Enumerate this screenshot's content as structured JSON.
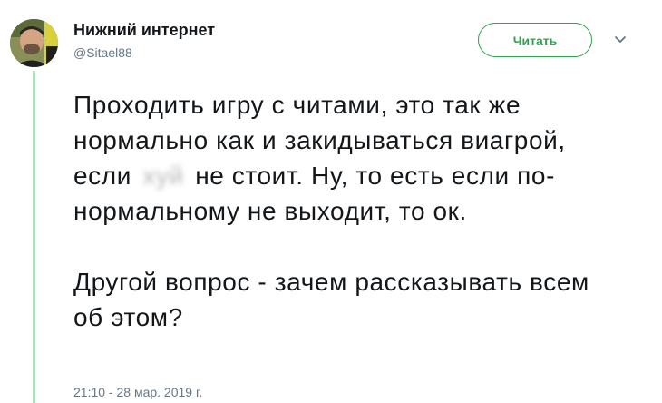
{
  "author": {
    "display_name": "Нижний интернет",
    "handle": "@Sitael88"
  },
  "follow_button": {
    "label": "Читать"
  },
  "menu": {
    "icon": "chevron-down-icon"
  },
  "tweet": {
    "paragraph1_part1": "Проходить игру с читами, это так же нормально как и закидываться виагрой, если",
    "censored_word": "хуй",
    "paragraph1_part2": "не стоит. Ну, то есть если по-нормальному не выходит, то ок.",
    "paragraph2": "Другой вопрос - зачем рассказывать всем об этом?"
  },
  "timestamp": "21:10 - 28 мар. 2019 г.",
  "colors": {
    "accent": "#30a14e",
    "thread_line": "#b7dfc0",
    "secondary_text": "#657786"
  }
}
